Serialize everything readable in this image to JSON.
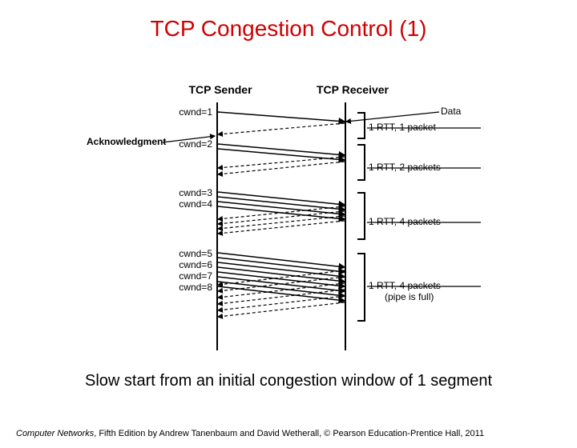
{
  "title": "TCP Congestion Control (1)",
  "sender_label": "TCP Sender",
  "receiver_label": "TCP Receiver",
  "ack_label": "Acknowledgment",
  "data_label": "Data",
  "cwnd": {
    "c1": "cwnd=1",
    "c2": "cwnd=2",
    "c3": "cwnd=3",
    "c4": "cwnd=4",
    "c5": "cwnd=5",
    "c6": "cwnd=6",
    "c7": "cwnd=7",
    "c8": "cwnd=8"
  },
  "rtt": {
    "r1": "1 RTT, 1 packet",
    "r2": "1 RTT, 2 packets",
    "r3": "1 RTT, 4 packets",
    "r4a": "1 RTT, 4 packets",
    "r4b": "(pipe is full)"
  },
  "caption": "Slow start from an initial congestion window of 1 segment",
  "footer_book": "Computer Networks",
  "footer_rest": ", Fifth Edition by Andrew Tanenbaum and David Wetherall, © Pearson Education-Prentice Hall, 2011"
}
